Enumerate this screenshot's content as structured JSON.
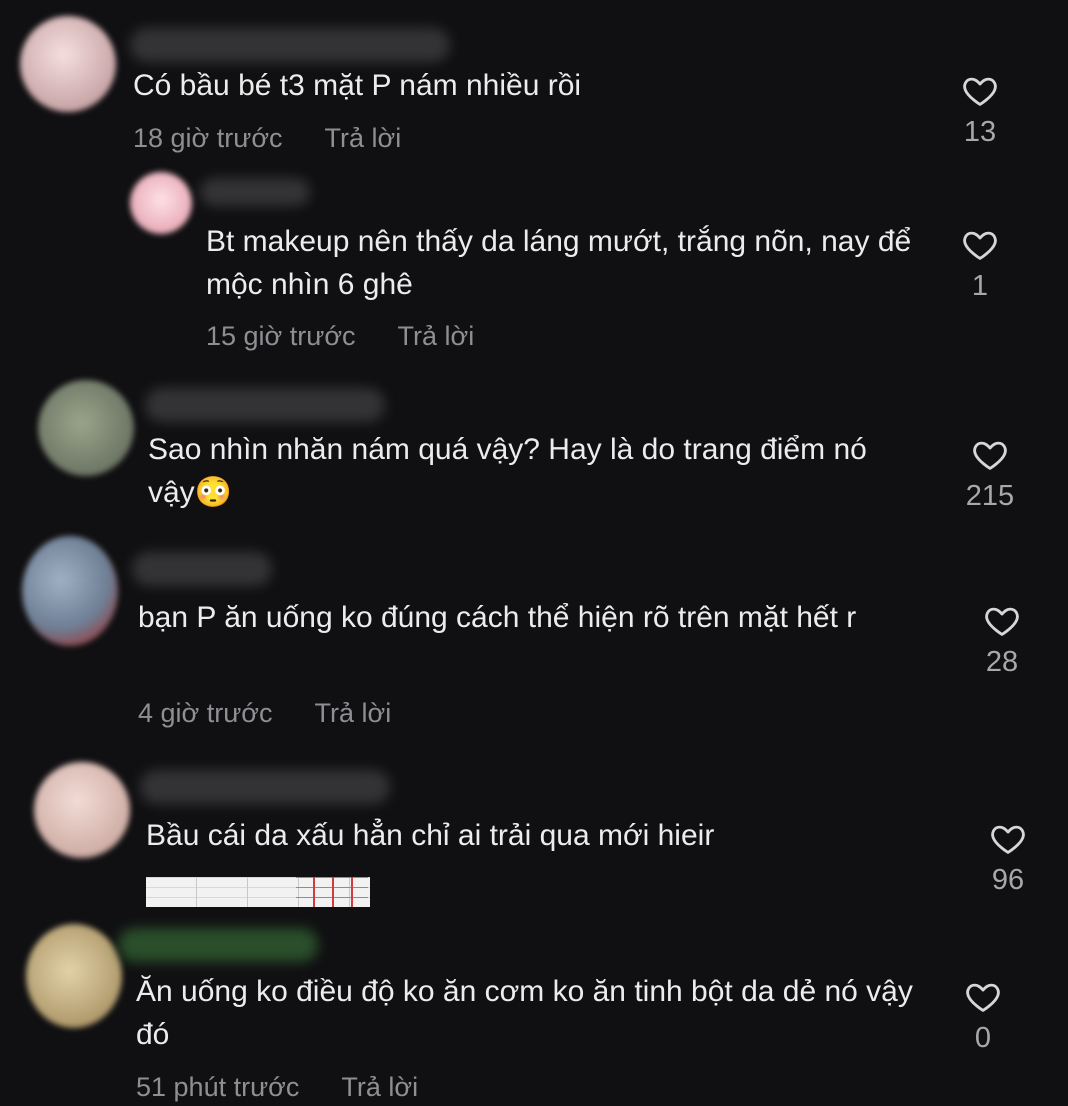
{
  "comments": [
    {
      "text": "Có bầu bé t3 mặt P nám nhiều rồi",
      "time": "18 giờ trước",
      "reply_label": "Trả lời",
      "likes": "13"
    },
    {
      "text": "Bt makeup nên thấy da láng mướt, trắng nõn, nay để mộc nhìn 6 ghê",
      "time": "15 giờ trước",
      "reply_label": "Trả lời",
      "likes": "1"
    },
    {
      "text": "Sao nhìn nhăn nám quá vậy? Hay là do trang điểm nó vậy😳",
      "likes": "215"
    },
    {
      "text": "bạn P ăn uống ko đúng cách thể hiện rõ trên mặt hết r",
      "time": "4 giờ trước",
      "reply_label": "Trả lời",
      "likes": "28"
    },
    {
      "text": "Bầu cái da xấu hẳn chỉ ai trải qua mới hieir",
      "likes": "96"
    },
    {
      "text": "Ăn uống ko điều độ ko ăn cơm ko ăn tinh bột da dẻ nó vậy đó",
      "time": "51 phút trước",
      "reply_label": "Trả lời",
      "likes": "0"
    }
  ],
  "colors": {
    "background": "#101012",
    "text": "#ececec",
    "meta": "#8e8e93"
  },
  "icons": {
    "like": "heart-outline-icon"
  }
}
